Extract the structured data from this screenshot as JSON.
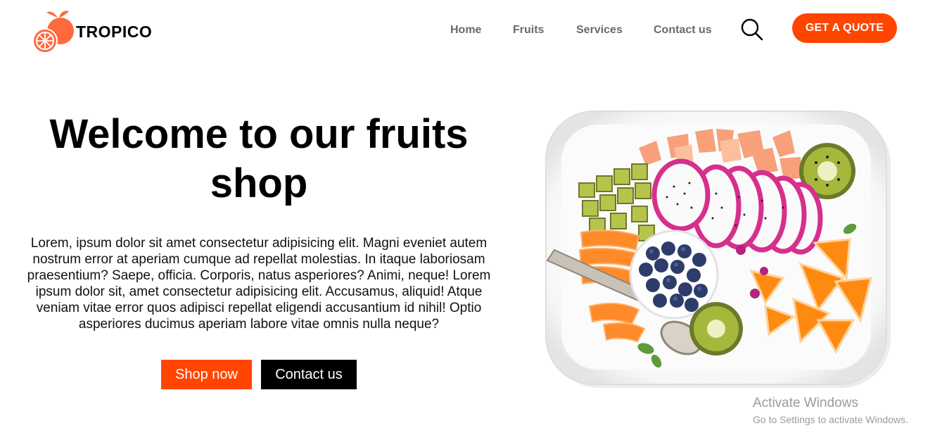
{
  "brand": {
    "name": "TROPICO",
    "accent_color": "#ff4500"
  },
  "nav": {
    "items": [
      {
        "label": "Home"
      },
      {
        "label": "Fruits"
      },
      {
        "label": "Services"
      },
      {
        "label": "Contact us"
      }
    ],
    "search_icon": "search-icon",
    "quote_button": "GET A QUOTE"
  },
  "hero": {
    "title": "Welcome to our fruits shop",
    "description": "Lorem, ipsum dolor sit amet consectetur adipisicing elit. Magni eveniet autem nostrum error at aperiam cumque ad repellat molestias. In itaque laboriosam praesentium? Saepe, officia. Corporis, natus asperiores? Animi, neque! Lorem ipsum dolor sit, amet consectetur adipisicing elit. Accusamus, aliquid! Atque veniam vitae error quos adipisci repellat eligendi accusantium id nihil! Optio asperiores ducimus aperiam labore vitae omnis nulla neque?",
    "shop_button": "Shop now",
    "contact_button": "Contact us",
    "image_icon": "fruit-plate-image"
  },
  "system": {
    "watermark_title": "Activate Windows",
    "watermark_sub": "Go to Settings to activate Windows."
  }
}
